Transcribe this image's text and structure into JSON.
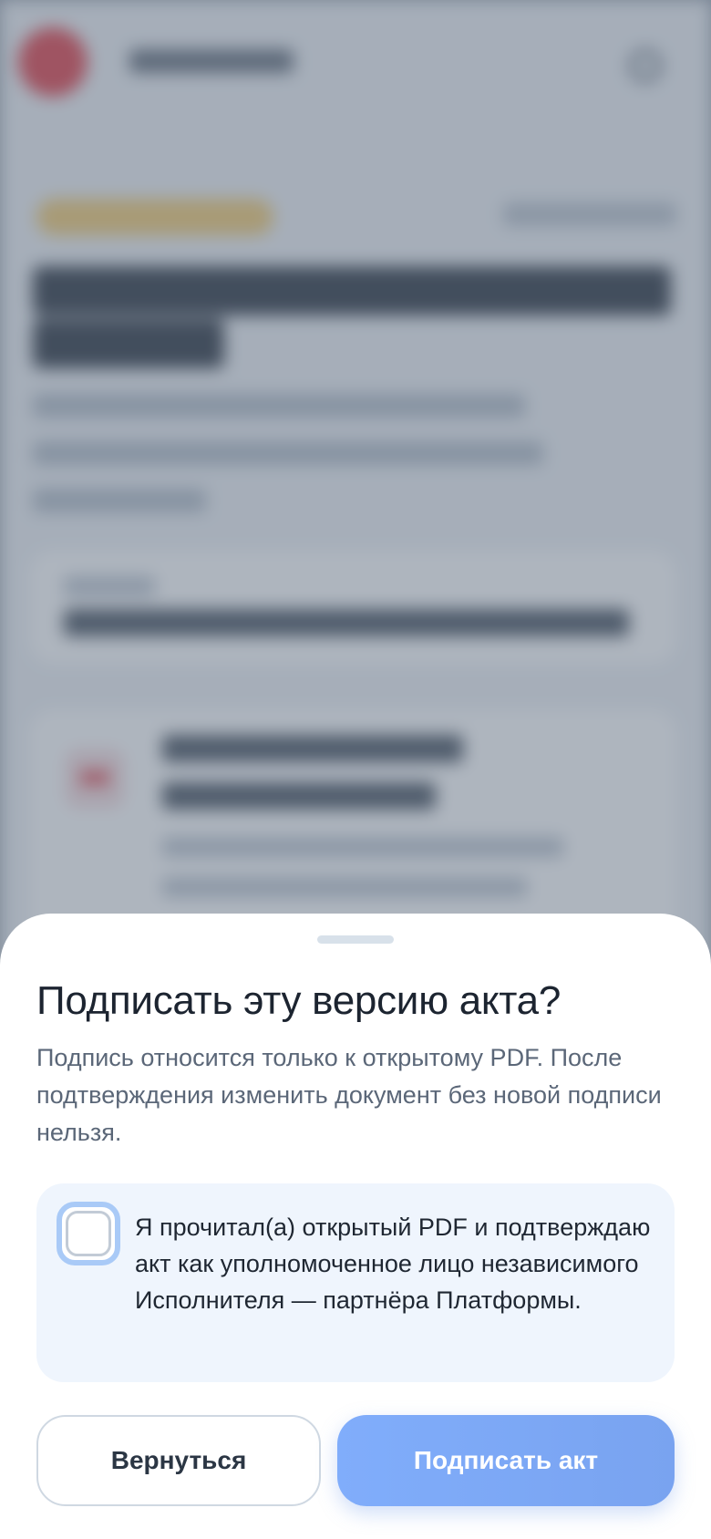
{
  "dialog": {
    "title": "Подписать эту версию акта?",
    "description": "Подпись относится только к открытому PDF. После подтверждения изменить документ без новой подписи нельзя.",
    "consent": {
      "text": "Я прочитал(а) открытый PDF и подтверждаю акт как уполномоченное лицо независимого Исполнителя — партнёра Платформы.",
      "checked": false
    },
    "buttons": {
      "back_label": "Вернуться",
      "sign_label": "Подписать акт"
    }
  },
  "colors": {
    "sign_button": "#80adfb",
    "consent_background": "#eff5fd",
    "brand_accent": "#e0353f"
  }
}
